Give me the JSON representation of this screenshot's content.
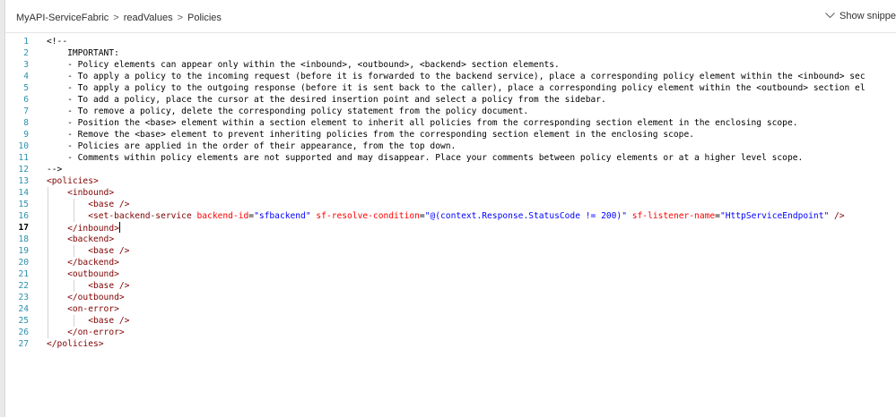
{
  "breadcrumb": {
    "items": [
      "MyAPI-ServiceFabric",
      "readValues",
      "Policies"
    ],
    "separator": ">"
  },
  "show_snippets_label": "Show snippe",
  "editor": {
    "active_line": 17,
    "lines": [
      {
        "n": "1",
        "tokens": [
          [
            "t-comment",
            "<!--"
          ]
        ]
      },
      {
        "n": "2",
        "tokens": [
          [
            "t-comment",
            "    IMPORTANT:"
          ]
        ]
      },
      {
        "n": "3",
        "tokens": [
          [
            "t-comment",
            "    - Policy elements can appear only within the <inbound>, <outbound>, <backend> section elements."
          ]
        ]
      },
      {
        "n": "4",
        "tokens": [
          [
            "t-comment",
            "    - To apply a policy to the incoming request (before it is forwarded to the backend service), place a corresponding policy element within the <inbound> sec"
          ]
        ]
      },
      {
        "n": "5",
        "tokens": [
          [
            "t-comment",
            "    - To apply a policy to the outgoing response (before it is sent back to the caller), place a corresponding policy element within the <outbound> section el"
          ]
        ]
      },
      {
        "n": "6",
        "tokens": [
          [
            "t-comment",
            "    - To add a policy, place the cursor at the desired insertion point and select a policy from the sidebar."
          ]
        ]
      },
      {
        "n": "7",
        "tokens": [
          [
            "t-comment",
            "    - To remove a policy, delete the corresponding policy statement from the policy document."
          ]
        ]
      },
      {
        "n": "8",
        "tokens": [
          [
            "t-comment",
            "    - Position the <base> element within a section element to inherit all policies from the corresponding section element in the enclosing scope."
          ]
        ]
      },
      {
        "n": "9",
        "tokens": [
          [
            "t-comment",
            "    - Remove the <base> element to prevent inheriting policies from the corresponding section element in the enclosing scope."
          ]
        ]
      },
      {
        "n": "10",
        "tokens": [
          [
            "t-comment",
            "    - Policies are applied in the order of their appearance, from the top down."
          ]
        ]
      },
      {
        "n": "11",
        "tokens": [
          [
            "t-comment",
            "    - Comments within policy elements are not supported and may disappear. Place your comments between policy elements or at a higher level scope."
          ]
        ]
      },
      {
        "n": "12",
        "tokens": [
          [
            "t-comment",
            "-->"
          ]
        ]
      },
      {
        "n": "13",
        "tokens": [
          [
            "t-tag",
            "<policies>"
          ]
        ]
      },
      {
        "n": "14",
        "tokens": [
          [
            "t-plain",
            "    "
          ],
          [
            "t-tag",
            "<inbound>"
          ]
        ]
      },
      {
        "n": "15",
        "tokens": [
          [
            "t-plain",
            "        "
          ],
          [
            "t-tag",
            "<base />"
          ]
        ]
      },
      {
        "n": "16",
        "tokens": [
          [
            "t-plain",
            "        "
          ],
          [
            "t-tag",
            "<set-backend-service "
          ],
          [
            "t-attr",
            "backend-id"
          ],
          [
            "t-plain",
            "="
          ],
          [
            "t-val",
            "\"sfbackend\""
          ],
          [
            "t-plain",
            " "
          ],
          [
            "t-attr",
            "sf-resolve-condition"
          ],
          [
            "t-plain",
            "="
          ],
          [
            "t-val",
            "\"@(context.Response.StatusCode != 200)\""
          ],
          [
            "t-plain",
            " "
          ],
          [
            "t-attr",
            "sf-listener-name"
          ],
          [
            "t-plain",
            "="
          ],
          [
            "t-val",
            "\"HttpServiceEndpoint\""
          ],
          [
            "t-plain",
            " "
          ],
          [
            "t-tag",
            "/>"
          ]
        ]
      },
      {
        "n": "17",
        "tokens": [
          [
            "t-plain",
            "    "
          ],
          [
            "t-tag",
            "</inbound>"
          ]
        ]
      },
      {
        "n": "18",
        "tokens": [
          [
            "t-plain",
            "    "
          ],
          [
            "t-tag",
            "<backend>"
          ]
        ]
      },
      {
        "n": "19",
        "tokens": [
          [
            "t-plain",
            "        "
          ],
          [
            "t-tag",
            "<base />"
          ]
        ]
      },
      {
        "n": "20",
        "tokens": [
          [
            "t-plain",
            "    "
          ],
          [
            "t-tag",
            "</backend>"
          ]
        ]
      },
      {
        "n": "21",
        "tokens": [
          [
            "t-plain",
            "    "
          ],
          [
            "t-tag",
            "<outbound>"
          ]
        ]
      },
      {
        "n": "22",
        "tokens": [
          [
            "t-plain",
            "        "
          ],
          [
            "t-tag",
            "<base />"
          ]
        ]
      },
      {
        "n": "23",
        "tokens": [
          [
            "t-plain",
            "    "
          ],
          [
            "t-tag",
            "</outbound>"
          ]
        ]
      },
      {
        "n": "24",
        "tokens": [
          [
            "t-plain",
            "    "
          ],
          [
            "t-tag",
            "<on-error>"
          ]
        ]
      },
      {
        "n": "25",
        "tokens": [
          [
            "t-plain",
            "        "
          ],
          [
            "t-tag",
            "<base />"
          ]
        ]
      },
      {
        "n": "26",
        "tokens": [
          [
            "t-plain",
            "    "
          ],
          [
            "t-tag",
            "</on-error>"
          ]
        ]
      },
      {
        "n": "27",
        "tokens": [
          [
            "t-tag",
            "</policies>"
          ]
        ]
      }
    ]
  },
  "colors": {
    "line_number": "#2b91af",
    "xml_tag": "#800000",
    "xml_attribute": "#ff0000",
    "xml_value": "#0000ff"
  }
}
